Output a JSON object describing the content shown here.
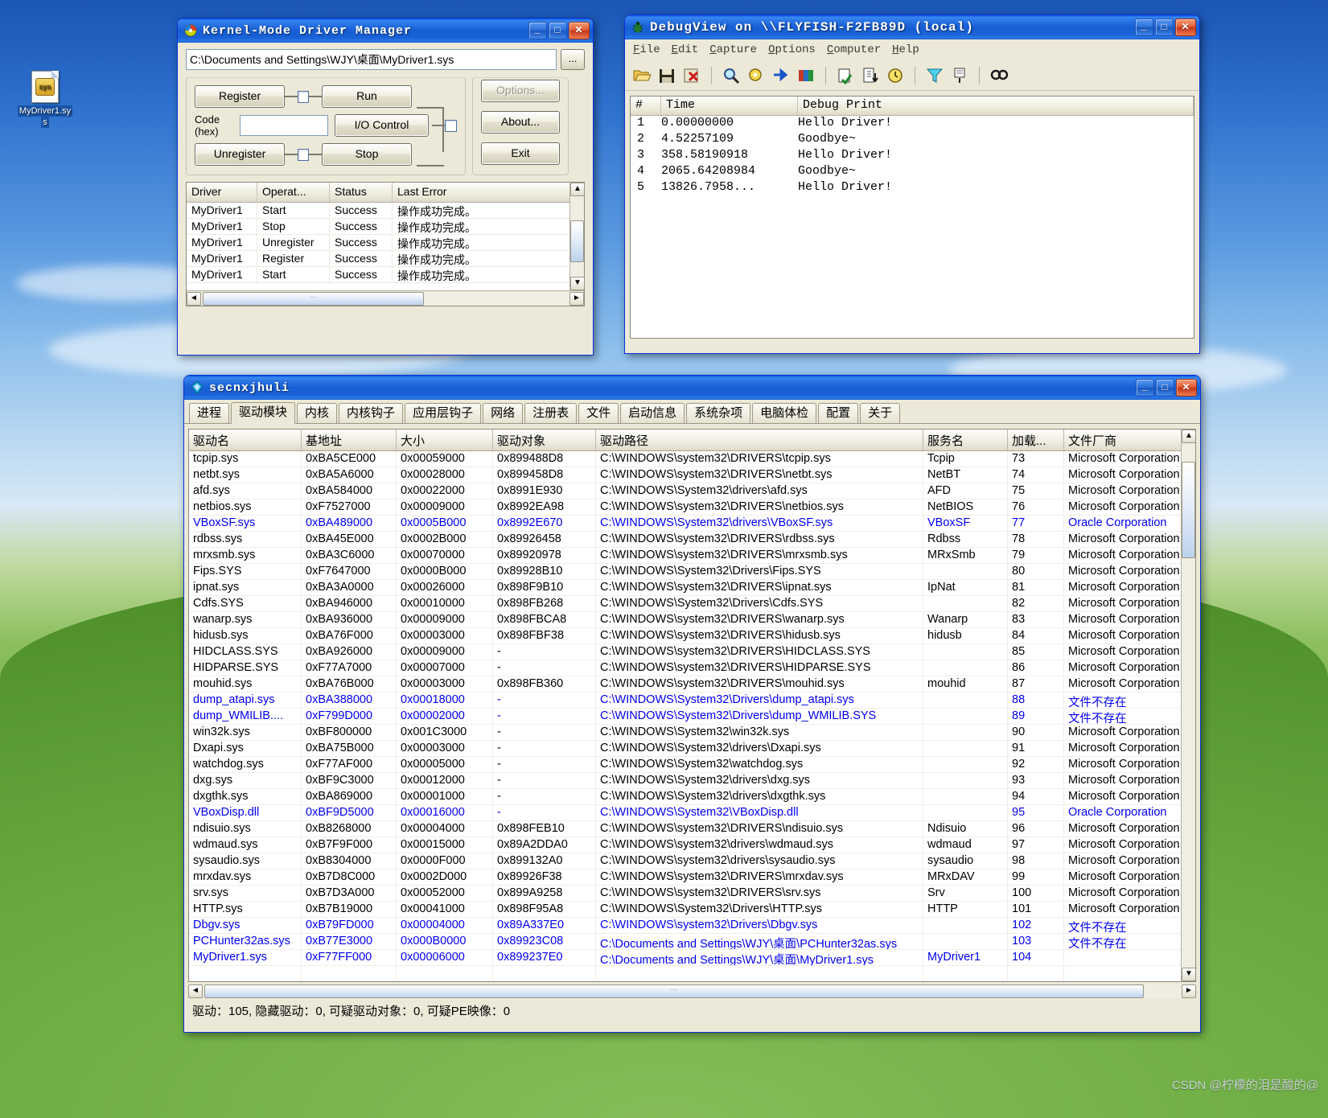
{
  "desktop": {
    "icon": {
      "name": "MyDriver1.sys",
      "label_line1": "MyDriver1.sy",
      "label_line2": "s"
    },
    "watermark": "CSDN @柠檬的泪是酸的@"
  },
  "kmdm": {
    "title": "Kernel-Mode Driver Manager",
    "buttons": {
      "minimize": "_",
      "maximize": "□",
      "close": "✕"
    },
    "path": {
      "value": "C:\\Documents and Settings\\WJY\\桌面\\MyDriver1.sys",
      "browse": "..."
    },
    "controls": {
      "register": "Register",
      "unregister": "Unregister",
      "run": "Run",
      "stop": "Stop",
      "io_control": "I/O Control",
      "code_label_1": "Code",
      "code_label_2": "(hex)",
      "code_value": "",
      "options": "Options...",
      "about": "About...",
      "exit": "Exit"
    },
    "list": {
      "columns": [
        "Driver",
        "Operat...",
        "Status",
        "Last Error"
      ],
      "rows": [
        [
          "MyDriver1",
          "Start",
          "Success",
          "操作成功完成。"
        ],
        [
          "MyDriver1",
          "Stop",
          "Success",
          "操作成功完成。"
        ],
        [
          "MyDriver1",
          "Unregister",
          "Success",
          "操作成功完成。"
        ],
        [
          "MyDriver1",
          "Register",
          "Success",
          "操作成功完成。"
        ],
        [
          "MyDriver1",
          "Start",
          "Success",
          "操作成功完成。"
        ]
      ]
    }
  },
  "debugview": {
    "title": "DebugView on \\\\FLYFISH-F2FB89D (local)",
    "menu": [
      "File",
      "Edit",
      "Capture",
      "Options",
      "Computer",
      "Help"
    ],
    "toolbar_icons": [
      "open-icon",
      "save-icon",
      "clear-icon",
      "find-highlight-icon",
      "capture-win32-icon",
      "capture-kernel-icon",
      "capture-events-icon",
      "autoscroll-icon",
      "clock-icon",
      "timer-icon",
      "filter-icon",
      "log-icon",
      "find-icon"
    ],
    "columns": [
      "#",
      "Time",
      "Debug Print"
    ],
    "rows": [
      {
        "n": "1",
        "time": "0.00000000",
        "msg": "Hello Driver!"
      },
      {
        "n": "2",
        "time": "4.52257109",
        "msg": "Goodbye~"
      },
      {
        "n": "3",
        "time": "358.58190918",
        "msg": "Hello Driver!"
      },
      {
        "n": "4",
        "time": "2065.64208984",
        "msg": "Goodbye~"
      },
      {
        "n": "5",
        "time": "13826.7958...",
        "msg": "Hello Driver!"
      }
    ]
  },
  "secnx": {
    "title": "secnxjhuli",
    "tabs": [
      "进程",
      "驱动模块",
      "内核",
      "内核钩子",
      "应用层钩子",
      "网络",
      "注册表",
      "文件",
      "启动信息",
      "系统杂项",
      "电脑体检",
      "配置",
      "关于"
    ],
    "active_tab": "驱动模块",
    "columns": [
      "驱动名",
      "基地址",
      "大小",
      "驱动对象",
      "驱动路径",
      "服务名",
      "加载...",
      "文件厂商"
    ],
    "status": "驱动：105, 隐藏驱动：0, 可疑驱动对象：0, 可疑PE映像：0",
    "rows": [
      {
        "name": "tcpip.sys",
        "base": "0xBA5CE000",
        "size": "0x00059000",
        "obj": "0x899488D8",
        "path": "C:\\WINDOWS\\system32\\DRIVERS\\tcpip.sys",
        "svc": "Tcpip",
        "ord": "73",
        "vendor": "Microsoft Corporation",
        "blue": false
      },
      {
        "name": "netbt.sys",
        "base": "0xBA5A6000",
        "size": "0x00028000",
        "obj": "0x899458D8",
        "path": "C:\\WINDOWS\\system32\\DRIVERS\\netbt.sys",
        "svc": "NetBT",
        "ord": "74",
        "vendor": "Microsoft Corporation",
        "blue": false
      },
      {
        "name": "afd.sys",
        "base": "0xBA584000",
        "size": "0x00022000",
        "obj": "0x8991E930",
        "path": "C:\\WINDOWS\\System32\\drivers\\afd.sys",
        "svc": "AFD",
        "ord": "75",
        "vendor": "Microsoft Corporation",
        "blue": false
      },
      {
        "name": "netbios.sys",
        "base": "0xF7527000",
        "size": "0x00009000",
        "obj": "0x8992EA98",
        "path": "C:\\WINDOWS\\system32\\DRIVERS\\netbios.sys",
        "svc": "NetBIOS",
        "ord": "76",
        "vendor": "Microsoft Corporation",
        "blue": false
      },
      {
        "name": "VBoxSF.sys",
        "base": "0xBA489000",
        "size": "0x0005B000",
        "obj": "0x8992E670",
        "path": "C:\\WINDOWS\\System32\\drivers\\VBoxSF.sys",
        "svc": "VBoxSF",
        "ord": "77",
        "vendor": "Oracle Corporation",
        "blue": true
      },
      {
        "name": "rdbss.sys",
        "base": "0xBA45E000",
        "size": "0x0002B000",
        "obj": "0x89926458",
        "path": "C:\\WINDOWS\\system32\\DRIVERS\\rdbss.sys",
        "svc": "Rdbss",
        "ord": "78",
        "vendor": "Microsoft Corporation",
        "blue": false
      },
      {
        "name": "mrxsmb.sys",
        "base": "0xBA3C6000",
        "size": "0x00070000",
        "obj": "0x89920978",
        "path": "C:\\WINDOWS\\system32\\DRIVERS\\mrxsmb.sys",
        "svc": "MRxSmb",
        "ord": "79",
        "vendor": "Microsoft Corporation",
        "blue": false
      },
      {
        "name": "Fips.SYS",
        "base": "0xF7647000",
        "size": "0x0000B000",
        "obj": "0x89928B10",
        "path": "C:\\WINDOWS\\System32\\Drivers\\Fips.SYS",
        "svc": "",
        "ord": "80",
        "vendor": "Microsoft Corporation",
        "blue": false
      },
      {
        "name": "ipnat.sys",
        "base": "0xBA3A0000",
        "size": "0x00026000",
        "obj": "0x898F9B10",
        "path": "C:\\WINDOWS\\system32\\DRIVERS\\ipnat.sys",
        "svc": "IpNat",
        "ord": "81",
        "vendor": "Microsoft Corporation",
        "blue": false
      },
      {
        "name": "Cdfs.SYS",
        "base": "0xBA946000",
        "size": "0x00010000",
        "obj": "0x898FB268",
        "path": "C:\\WINDOWS\\System32\\Drivers\\Cdfs.SYS",
        "svc": "",
        "ord": "82",
        "vendor": "Microsoft Corporation",
        "blue": false
      },
      {
        "name": "wanarp.sys",
        "base": "0xBA936000",
        "size": "0x00009000",
        "obj": "0x898FBCA8",
        "path": "C:\\WINDOWS\\system32\\DRIVERS\\wanarp.sys",
        "svc": "Wanarp",
        "ord": "83",
        "vendor": "Microsoft Corporation",
        "blue": false
      },
      {
        "name": "hidusb.sys",
        "base": "0xBA76F000",
        "size": "0x00003000",
        "obj": "0x898FBF38",
        "path": "C:\\WINDOWS\\system32\\DRIVERS\\hidusb.sys",
        "svc": "hidusb",
        "ord": "84",
        "vendor": "Microsoft Corporation",
        "blue": false
      },
      {
        "name": "HIDCLASS.SYS",
        "base": "0xBA926000",
        "size": "0x00009000",
        "obj": "-",
        "path": "C:\\WINDOWS\\system32\\DRIVERS\\HIDCLASS.SYS",
        "svc": "",
        "ord": "85",
        "vendor": "Microsoft Corporation",
        "blue": false
      },
      {
        "name": "HIDPARSE.SYS",
        "base": "0xF77A7000",
        "size": "0x00007000",
        "obj": "-",
        "path": "C:\\WINDOWS\\system32\\DRIVERS\\HIDPARSE.SYS",
        "svc": "",
        "ord": "86",
        "vendor": "Microsoft Corporation",
        "blue": false
      },
      {
        "name": "mouhid.sys",
        "base": "0xBA76B000",
        "size": "0x00003000",
        "obj": "0x898FB360",
        "path": "C:\\WINDOWS\\system32\\DRIVERS\\mouhid.sys",
        "svc": "mouhid",
        "ord": "87",
        "vendor": "Microsoft Corporation",
        "blue": false
      },
      {
        "name": "dump_atapi.sys",
        "base": "0xBA388000",
        "size": "0x00018000",
        "obj": "-",
        "path": "C:\\WINDOWS\\System32\\Drivers\\dump_atapi.sys",
        "svc": "",
        "ord": "88",
        "vendor": "文件不存在",
        "blue": true
      },
      {
        "name": "dump_WMILIB....",
        "base": "0xF799D000",
        "size": "0x00002000",
        "obj": "-",
        "path": "C:\\WINDOWS\\System32\\Drivers\\dump_WMILIB.SYS",
        "svc": "",
        "ord": "89",
        "vendor": "文件不存在",
        "blue": true
      },
      {
        "name": "win32k.sys",
        "base": "0xBF800000",
        "size": "0x001C3000",
        "obj": "-",
        "path": "C:\\WINDOWS\\System32\\win32k.sys",
        "svc": "",
        "ord": "90",
        "vendor": "Microsoft Corporation",
        "blue": false
      },
      {
        "name": "Dxapi.sys",
        "base": "0xBA75B000",
        "size": "0x00003000",
        "obj": "-",
        "path": "C:\\WINDOWS\\System32\\drivers\\Dxapi.sys",
        "svc": "",
        "ord": "91",
        "vendor": "Microsoft Corporation",
        "blue": false
      },
      {
        "name": "watchdog.sys",
        "base": "0xF77AF000",
        "size": "0x00005000",
        "obj": "-",
        "path": "C:\\WINDOWS\\System32\\watchdog.sys",
        "svc": "",
        "ord": "92",
        "vendor": "Microsoft Corporation",
        "blue": false
      },
      {
        "name": "dxg.sys",
        "base": "0xBF9C3000",
        "size": "0x00012000",
        "obj": "-",
        "path": "C:\\WINDOWS\\System32\\drivers\\dxg.sys",
        "svc": "",
        "ord": "93",
        "vendor": "Microsoft Corporation",
        "blue": false
      },
      {
        "name": "dxgthk.sys",
        "base": "0xBA869000",
        "size": "0x00001000",
        "obj": "-",
        "path": "C:\\WINDOWS\\System32\\drivers\\dxgthk.sys",
        "svc": "",
        "ord": "94",
        "vendor": "Microsoft Corporation",
        "blue": false
      },
      {
        "name": "VBoxDisp.dll",
        "base": "0xBF9D5000",
        "size": "0x00016000",
        "obj": "-",
        "path": "C:\\WINDOWS\\System32\\VBoxDisp.dll",
        "svc": "",
        "ord": "95",
        "vendor": "Oracle Corporation",
        "blue": true
      },
      {
        "name": "ndisuio.sys",
        "base": "0xB8268000",
        "size": "0x00004000",
        "obj": "0x898FEB10",
        "path": "C:\\WINDOWS\\system32\\DRIVERS\\ndisuio.sys",
        "svc": "Ndisuio",
        "ord": "96",
        "vendor": "Microsoft Corporation",
        "blue": false
      },
      {
        "name": "wdmaud.sys",
        "base": "0xB7F9F000",
        "size": "0x00015000",
        "obj": "0x89A2DDA0",
        "path": "C:\\WINDOWS\\system32\\drivers\\wdmaud.sys",
        "svc": "wdmaud",
        "ord": "97",
        "vendor": "Microsoft Corporation",
        "blue": false
      },
      {
        "name": "sysaudio.sys",
        "base": "0xB8304000",
        "size": "0x0000F000",
        "obj": "0x899132A0",
        "path": "C:\\WINDOWS\\system32\\drivers\\sysaudio.sys",
        "svc": "sysaudio",
        "ord": "98",
        "vendor": "Microsoft Corporation",
        "blue": false
      },
      {
        "name": "mrxdav.sys",
        "base": "0xB7D8C000",
        "size": "0x0002D000",
        "obj": "0x89926F38",
        "path": "C:\\WINDOWS\\system32\\DRIVERS\\mrxdav.sys",
        "svc": "MRxDAV",
        "ord": "99",
        "vendor": "Microsoft Corporation",
        "blue": false
      },
      {
        "name": "srv.sys",
        "base": "0xB7D3A000",
        "size": "0x00052000",
        "obj": "0x899A9258",
        "path": "C:\\WINDOWS\\system32\\DRIVERS\\srv.sys",
        "svc": "Srv",
        "ord": "100",
        "vendor": "Microsoft Corporation",
        "blue": false
      },
      {
        "name": "HTTP.sys",
        "base": "0xB7B19000",
        "size": "0x00041000",
        "obj": "0x898F95A8",
        "path": "C:\\WINDOWS\\System32\\Drivers\\HTTP.sys",
        "svc": "HTTP",
        "ord": "101",
        "vendor": "Microsoft Corporation",
        "blue": false
      },
      {
        "name": "Dbgv.sys",
        "base": "0xB79FD000",
        "size": "0x00004000",
        "obj": "0x89A337E0",
        "path": "C:\\WINDOWS\\system32\\Drivers\\Dbgv.sys",
        "svc": "",
        "ord": "102",
        "vendor": "文件不存在",
        "blue": true
      },
      {
        "name": "PCHunter32as.sys",
        "base": "0xB77E3000",
        "size": "0x000B0000",
        "obj": "0x89923C08",
        "path": "C:\\Documents and Settings\\WJY\\桌面\\PCHunter32as.sys",
        "svc": "",
        "ord": "103",
        "vendor": "文件不存在",
        "blue": true
      },
      {
        "name": "MyDriver1.sys",
        "base": "0xF77FF000",
        "size": "0x00006000",
        "obj": "0x899237E0",
        "path": "C:\\Documents and Settings\\WJY\\桌面\\MyDriver1.sys",
        "svc": "MyDriver1",
        "ord": "104",
        "vendor": "",
        "blue": true
      }
    ]
  }
}
